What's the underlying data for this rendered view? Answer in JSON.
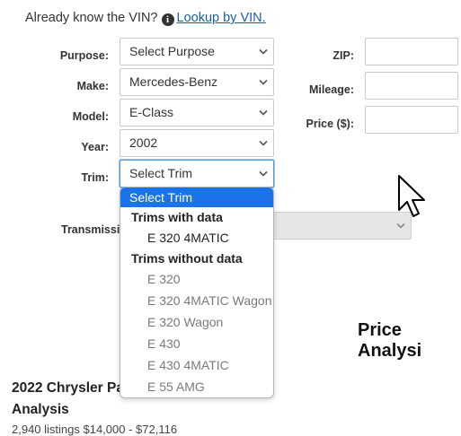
{
  "vin": {
    "prompt": "Already know the VIN?",
    "info_icon": "i",
    "lookup_link": "Lookup by VIN."
  },
  "form": {
    "purpose": {
      "label": "Purpose:",
      "value": "Select Purpose"
    },
    "make": {
      "label": "Make:",
      "value": "Mercedes-Benz"
    },
    "model": {
      "label": "Model:",
      "value": "E-Class"
    },
    "year": {
      "label": "Year:",
      "value": "2002"
    },
    "trim": {
      "label": "Trim:",
      "value": "Select Trim"
    },
    "transmission": {
      "label": "Transmissio",
      "value": ""
    },
    "zip": {
      "label": "ZIP:",
      "value": ""
    },
    "mileage": {
      "label": "Mileage:",
      "value": ""
    },
    "price": {
      "label": "Price ($):",
      "value": ""
    }
  },
  "trim_dropdown": {
    "selected": "Select Trim",
    "group_with_data": "Trims with data",
    "with_data": [
      "E 320 4MATIC"
    ],
    "group_without_data": "Trims without data",
    "without_data": [
      "E 320",
      "E 320 4MATIC Wagon",
      "E 320 Wagon",
      "E 430",
      "E 430 4MATIC",
      "E 55 AMG"
    ]
  },
  "content": {
    "price_analysis_heading": "Price Analysi",
    "article_title_line1": "2022 Chrysler Pa",
    "article_title_line2": "Analysis",
    "cut_off_text": "2,940 listings $14,000 - $72,116"
  },
  "icons": {
    "chevron": "chevron-down-icon",
    "cursor": "mouse-pointer-icon",
    "info": "info-circle-icon"
  },
  "colors": {
    "link": "#1a5fa8",
    "dropdown_highlight": "#1a73e8",
    "focus_border": "#5b9bd5"
  }
}
